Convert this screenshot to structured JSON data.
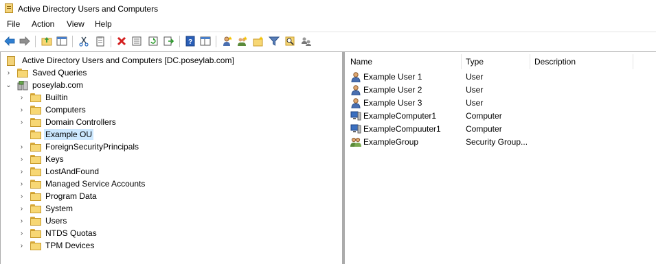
{
  "window": {
    "title": "Active Directory Users and Computers"
  },
  "menu": [
    "File",
    "Action",
    "View",
    "Help"
  ],
  "toolbar": {
    "icons": [
      "back-arrow-icon",
      "forward-arrow-icon",
      "up-folder-icon",
      "show-hide-tree-icon",
      "cut-icon",
      "copy-icon",
      "delete-icon",
      "properties-icon",
      "refresh-icon",
      "export-list-icon",
      "help-icon",
      "console-help-icon",
      "new-user-icon",
      "new-group-icon",
      "new-ou-icon",
      "filter-icon",
      "find-icon",
      "add-to-group-icon"
    ]
  },
  "tree": {
    "root": "Active Directory Users and Computers [DC.poseylab.com]",
    "saved_queries": "Saved Queries",
    "domain": "poseylab.com",
    "children": [
      "Builtin",
      "Computers",
      "Domain Controllers",
      "Example OU",
      "ForeignSecurityPrincipals",
      "Keys",
      "LostAndFound",
      "Managed Service Accounts",
      "Program Data",
      "System",
      "Users",
      "NTDS Quotas",
      "TPM Devices"
    ],
    "selected": "Example OU"
  },
  "list": {
    "columns": [
      "Name",
      "Type",
      "Description"
    ],
    "rows": [
      {
        "name": "Example User 1",
        "type": "User",
        "icon": "user-icon"
      },
      {
        "name": "Example User 2",
        "type": "User",
        "icon": "user-icon"
      },
      {
        "name": "Example User 3",
        "type": "User",
        "icon": "user-icon"
      },
      {
        "name": "ExampleComputer1",
        "type": "Computer",
        "icon": "computer-icon"
      },
      {
        "name": "ExampleCompuuter1",
        "type": "Computer",
        "icon": "computer-icon"
      },
      {
        "name": "ExampleGroup",
        "type": "Security Group...",
        "icon": "group-icon"
      }
    ]
  },
  "colors": {
    "selection": "#cce8ff",
    "folder": "#f7d774",
    "pane-divider": "#ababab"
  }
}
